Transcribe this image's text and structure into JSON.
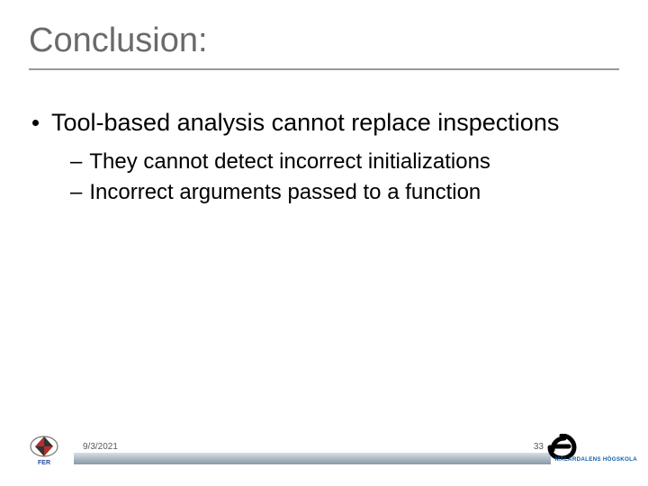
{
  "title": "Conclusion:",
  "bullets": [
    {
      "text": "Tool-based analysis cannot replace inspections",
      "subs": [
        "They cannot detect incorrect initializations",
        "Incorrect arguments passed to a function"
      ]
    }
  ],
  "footer": {
    "date": "9/3/2021",
    "page": "33",
    "right_logo_text": "MÄLARDALENS HÖGSKOLA"
  }
}
